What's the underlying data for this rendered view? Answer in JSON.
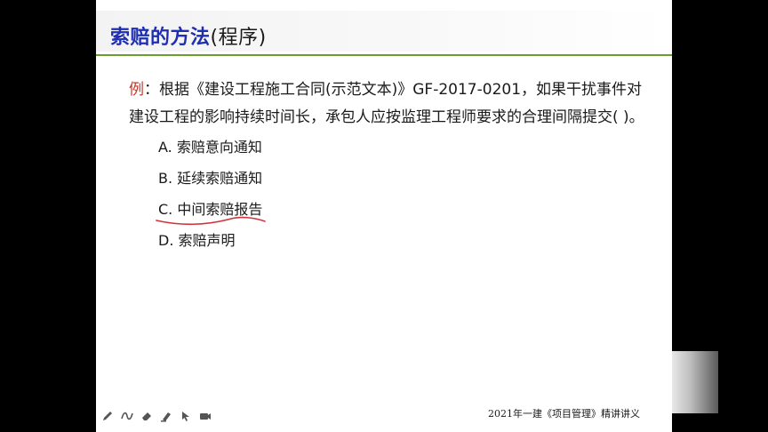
{
  "slide": {
    "title_main": "索赔的方法",
    "title_paren": "(程序)",
    "question_prefix": "例",
    "question_text": "：根据《建设工程施工合同(示范文本)》GF-2017-0201，如果干扰事件对建设工程的影响持续时间长，承包人应按监理工程师要求的合理间隔提交(    )。",
    "options": [
      "A. 索赔意向通知",
      "B. 延续索赔通知",
      "C. 中间索赔报告",
      "D. 索赔声明"
    ],
    "footer": "2021年一建《项目管理》精讲讲义"
  },
  "toolbar": {
    "icons": [
      "pen-icon",
      "curve-icon",
      "eraser-icon",
      "highlighter-icon",
      "pointer-icon",
      "camera-icon"
    ]
  },
  "colors": {
    "title": "#1f2fb2",
    "rule": "#6a9e2f",
    "prefix": "#c0392b",
    "annotation": "#d0343a"
  }
}
